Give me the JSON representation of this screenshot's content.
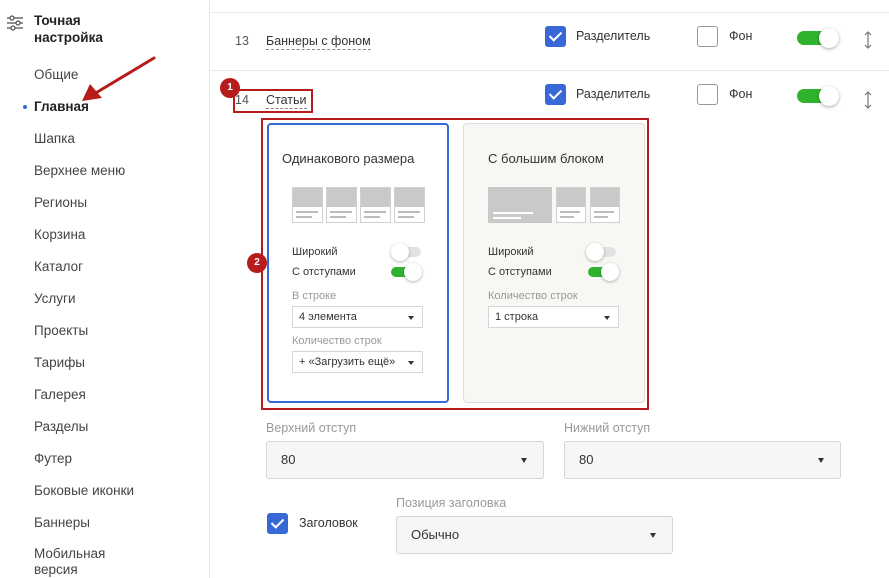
{
  "sidebar": {
    "title": "Точная настройка",
    "items": [
      {
        "label": "Общие"
      },
      {
        "label": "Главная"
      },
      {
        "label": "Шапка"
      },
      {
        "label": "Верхнее меню"
      },
      {
        "label": "Регионы"
      },
      {
        "label": "Корзина"
      },
      {
        "label": "Каталог"
      },
      {
        "label": "Услуги"
      },
      {
        "label": "Проекты"
      },
      {
        "label": "Тарифы"
      },
      {
        "label": "Галерея"
      },
      {
        "label": "Разделы"
      },
      {
        "label": "Футер"
      },
      {
        "label": "Боковые иконки"
      },
      {
        "label": "Баннеры"
      },
      {
        "label": "Мобильная версия"
      }
    ],
    "active_index": 1
  },
  "rows": [
    {
      "number": "13",
      "name": "Баннеры с фоном",
      "divider_label": "Разделитель",
      "divider_checked": true,
      "background_label": "Фон",
      "background_checked": false,
      "enabled": true
    },
    {
      "number": "14",
      "name": "Статьи",
      "divider_label": "Разделитель",
      "divider_checked": true,
      "background_label": "Фон",
      "background_checked": false,
      "enabled": true
    }
  ],
  "badges": {
    "first": "1",
    "second": "2"
  },
  "cards": [
    {
      "title": "Одинакового размера",
      "selected": true,
      "wide_label": "Широкий",
      "wide_on": false,
      "padding_label": "С отступами",
      "padding_on": true,
      "per_row_label": "В строке",
      "per_row_value": "4 элемента",
      "rows_label": "Количество строк",
      "rows_value": "+ «Загрузить ещё»"
    },
    {
      "title": "С большим блоком",
      "selected": false,
      "wide_label": "Широкий",
      "wide_on": false,
      "padding_label": "С отступами",
      "padding_on": true,
      "rows_label": "Количество строк",
      "rows_value": "1 строка"
    }
  ],
  "spacing": {
    "top_label": "Верхний отступ",
    "top_value": "80",
    "bottom_label": "Нижний отступ",
    "bottom_value": "80"
  },
  "heading": {
    "checkbox_label": "Заголовок",
    "checked": true,
    "position_label": "Позиция заголовка",
    "position_value": "Обычно"
  },
  "colors": {
    "accent": "#3867d6",
    "toggle_on": "#2fb32f",
    "annotation": "#b71c1c"
  }
}
